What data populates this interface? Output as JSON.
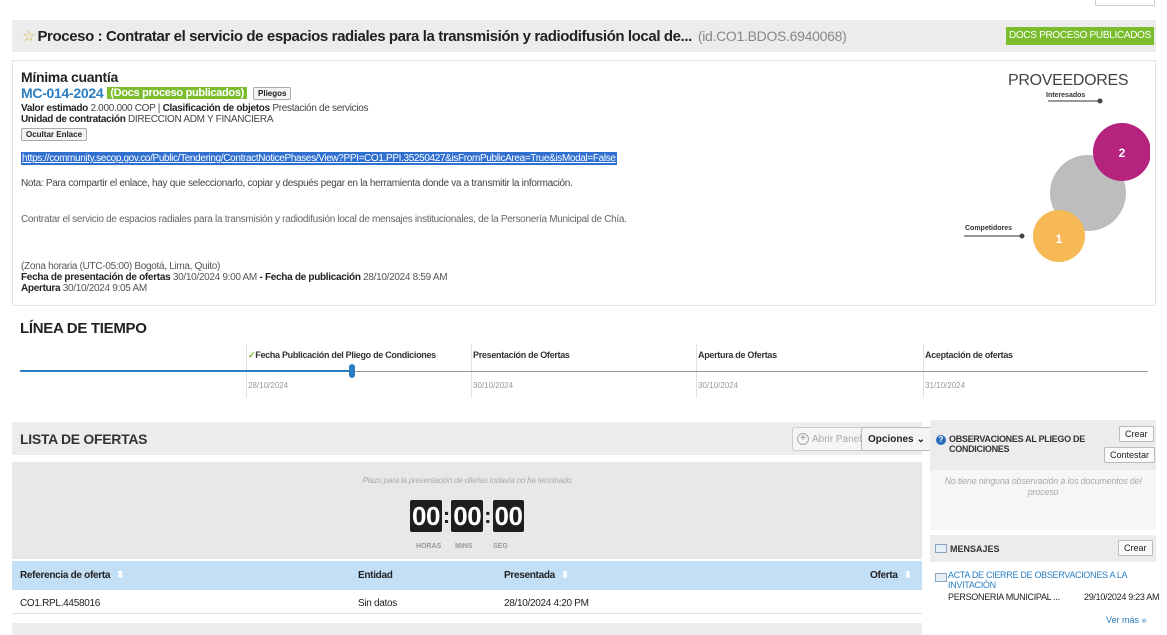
{
  "header": {
    "title": "Proceso : Contratar el servicio de espacios radiales para la transmisión y radiodifusión local de...",
    "process_id": "(id.CO1.BDOS.6940068)",
    "docs_button": "DOCS PROCESO PUBLICADOS"
  },
  "info": {
    "modalidad": "Mínima cuantía",
    "reference": "MC-014-2024",
    "status_badge": "(Docs proceso publicados)",
    "pliegos_button": "Pliegos",
    "valor_label": "Valor estimado",
    "valor_value": "2.000.000 COP",
    "clasif_label": "Clasificación de objetos",
    "clasif_value": "Prestación de servicios",
    "unidad_label": "Unidad de contratación",
    "unidad_value": "DIRECCION ADM Y FINANCIERA",
    "ocultar_button": "Ocultar Enlace",
    "link": "https://community.secop.gov.co/Public/Tendering/ContractNoticePhases/View?PPI=CO1.PPI.35250427&isFromPublicArea=True&isModal=False",
    "nota": "Nota: Para compartir el enlace, hay que seleccionarlo, copiar y después pegar en la herramienta donde va a transmitir la información.",
    "description": "Contratar el servicio de espacios radiales para la transmisión y radiodifusión local de mensajes institucionales, de la Personería Municipal de Chía.",
    "timezone": "(Zona horaria (UTC-05:00) Bogotá, Lima, Quito)",
    "fecha_pres_label": "Fecha de presentación de ofertas",
    "fecha_pres_value": "30/10/2024 9:00 AM",
    "fecha_pub_label": "Fecha de publicación",
    "fecha_pub_value": "28/10/2024 8:59 AM",
    "apertura_label": "Apertura",
    "apertura_value": "30/10/2024 9:05 AM"
  },
  "proveedores": {
    "title": "PROVEEDORES",
    "interesados_label": "Interesados",
    "interesados_count": "2",
    "competidores_label": "Competidores",
    "competidores_count": "1",
    "colors": {
      "interesados": "#b5237f",
      "neutral": "#bdbdbd",
      "competidores": "#f7b955"
    }
  },
  "timeline": {
    "title": "LÍNEA DE TIEMPO",
    "progress_fraction": 0.294,
    "stages": [
      {
        "label": "Fecha Publicación del Pliego de Condiciones",
        "date": "28/10/2024"
      },
      {
        "label": "Presentación de Ofertas",
        "date": "30/10/2024"
      },
      {
        "label": "Apertura de Ofertas",
        "date": "30/10/2024"
      },
      {
        "label": "Aceptación de ofertas",
        "date": "31/10/2024"
      }
    ]
  },
  "ofertas": {
    "title": "LISTA DE OFERTAS",
    "abrir_panel": "Abrir Panel",
    "opciones": "Opciones",
    "plazo_text": "Plazo para la presentación de ofertas todavía no ha terminado",
    "countdown": {
      "hours": "00",
      "mins": "00",
      "secs": "00",
      "hours_label": "HORAS",
      "mins_label": "MINS",
      "secs_label": "SEG"
    },
    "columns": [
      "Referencia de oferta",
      "Entidad",
      "Presentada",
      "Oferta"
    ],
    "rows": [
      {
        "ref": "CO1.RPL.4458016",
        "entidad": "Sin datos",
        "presentada": "28/10/2024 4:20 PM"
      }
    ]
  },
  "observaciones": {
    "title": "OBSERVACIONES AL PLIEGO DE CONDICIONES",
    "crear": "Crear",
    "contestar": "Contestar",
    "empty": "No tiene ninguna observación a los documentos del proceso"
  },
  "mensajes": {
    "title": "MENSAJES",
    "crear": "Crear",
    "item_title": "ACTA DE CIERRE DE OBSERVACIONES A LA INVITACIÓN",
    "item_from": "PERSONERIA MUNICIPAL ...",
    "item_date": "29/10/2024 9:23 AM",
    "ver_mas": "Ver más »"
  },
  "colors": {
    "accent_blue": "#2a7ec1",
    "green": "#7bbd2e",
    "header_bg": "#ececec",
    "table_head": "#c3dff6"
  }
}
